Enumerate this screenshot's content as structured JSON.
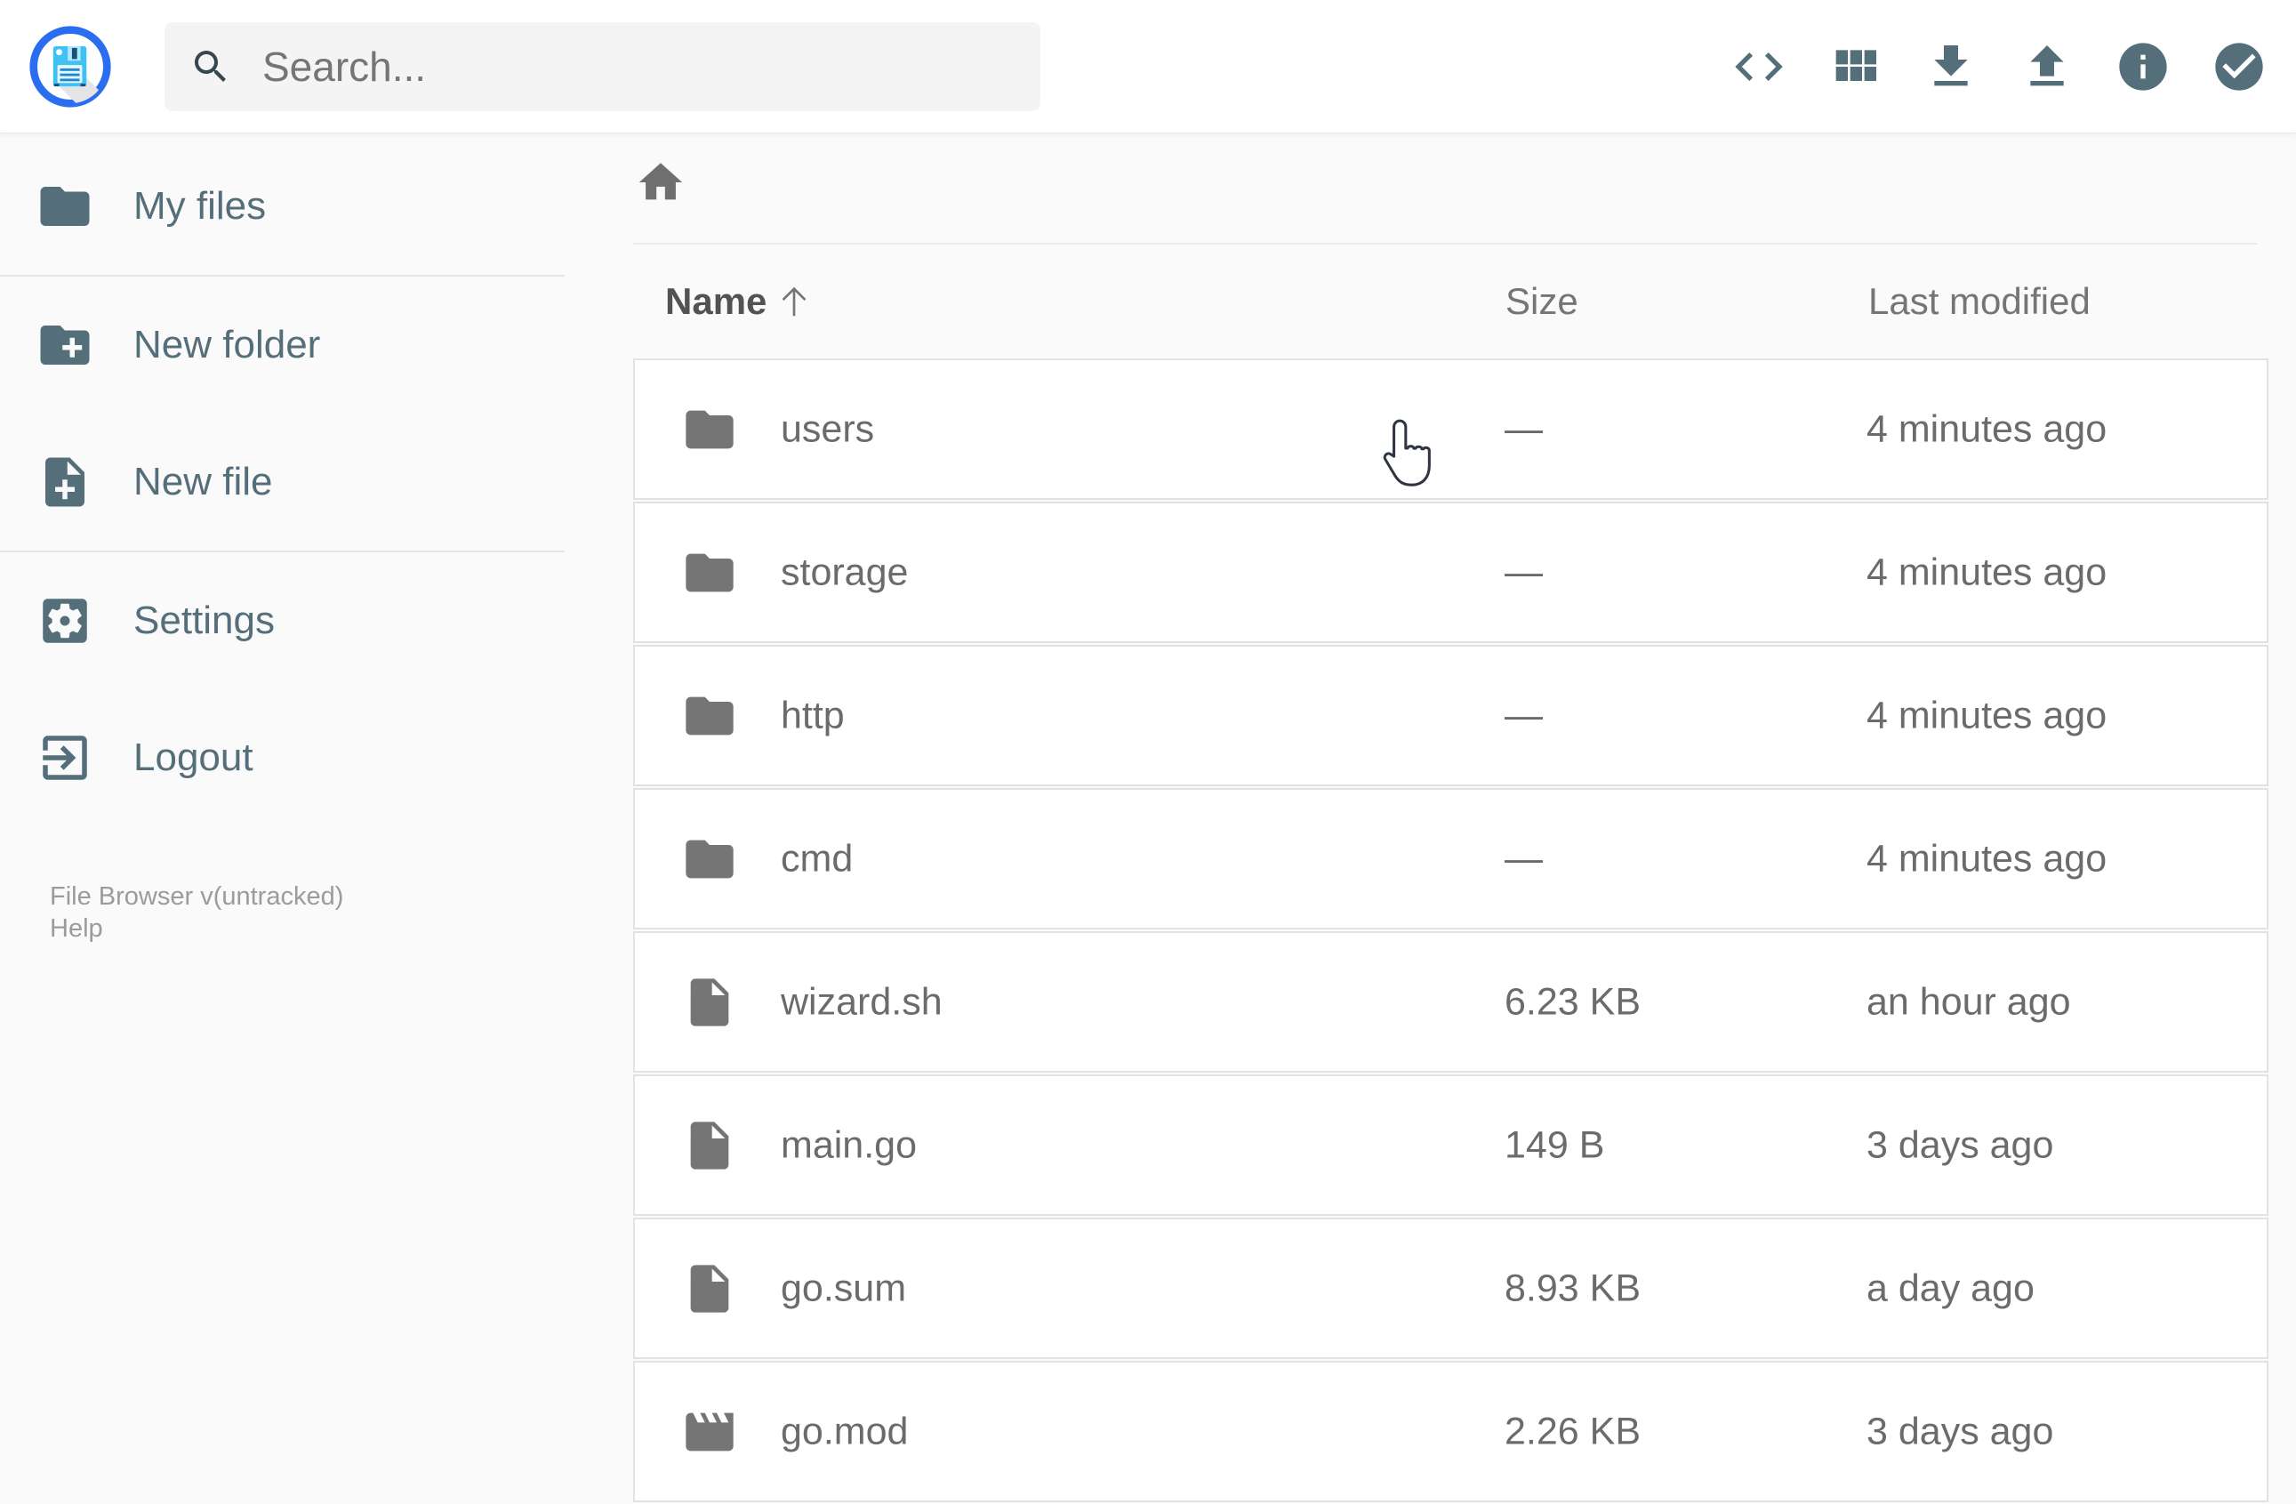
{
  "app_title": "File Browser",
  "colors": {
    "accent_blue": "#2a6df0",
    "floppy_blue": "#3ec1f3",
    "floppy_dark": "#1565c0",
    "slate": "#546e7a",
    "row_gray": "#6b6b6b",
    "icon_gray": "#757575",
    "muted_gray": "#9b9b9b",
    "page_bg": "#fafafa",
    "header_bg": "#ffffff",
    "search_bg": "#f4f4f4",
    "border": "#e2e2e2"
  },
  "header": {
    "logo": "filebrowser-floppy-logo",
    "search": {
      "placeholder": "Search...",
      "icon": "search"
    },
    "actions": [
      {
        "name": "raw-code-button",
        "icon": "code"
      },
      {
        "name": "switch-view-button",
        "icon": "view-module"
      },
      {
        "name": "download-button",
        "icon": "download"
      },
      {
        "name": "upload-button",
        "icon": "upload"
      },
      {
        "name": "info-button",
        "icon": "info"
      },
      {
        "name": "select-multiple-button",
        "icon": "check-circle"
      }
    ]
  },
  "sidebar": {
    "items": [
      {
        "label": "My files",
        "icon": "folder"
      },
      {
        "label": "New folder",
        "icon": "create-new-folder"
      },
      {
        "label": "New file",
        "icon": "note-add"
      },
      {
        "label": "Settings",
        "icon": "settings-applications"
      },
      {
        "label": "Logout",
        "icon": "exit-to-app"
      }
    ],
    "dividers_after": [
      0,
      2
    ],
    "footer": {
      "version": "File Browser v(untracked)",
      "help": "Help"
    }
  },
  "breadcrumb": {
    "home_icon": "home"
  },
  "listing": {
    "columns": {
      "name": "Name",
      "size": "Size",
      "modified": "Last modified"
    },
    "sort": {
      "column": "name",
      "direction": "asc"
    },
    "rows": [
      {
        "icon": "folder",
        "name": "users",
        "size": "—",
        "modified": "4 minutes ago"
      },
      {
        "icon": "folder",
        "name": "storage",
        "size": "—",
        "modified": "4 minutes ago"
      },
      {
        "icon": "folder",
        "name": "http",
        "size": "—",
        "modified": "4 minutes ago"
      },
      {
        "icon": "folder",
        "name": "cmd",
        "size": "—",
        "modified": "4 minutes ago"
      },
      {
        "icon": "insert-drive-file",
        "name": "wizard.sh",
        "size": "6.23 KB",
        "modified": "an hour ago"
      },
      {
        "icon": "insert-drive-file",
        "name": "main.go",
        "size": "149 B",
        "modified": "3 days ago"
      },
      {
        "icon": "insert-drive-file",
        "name": "go.sum",
        "size": "8.93 KB",
        "modified": "a day ago"
      },
      {
        "icon": "movie",
        "name": "go.mod",
        "size": "2.26 KB",
        "modified": "3 days ago"
      }
    ]
  }
}
